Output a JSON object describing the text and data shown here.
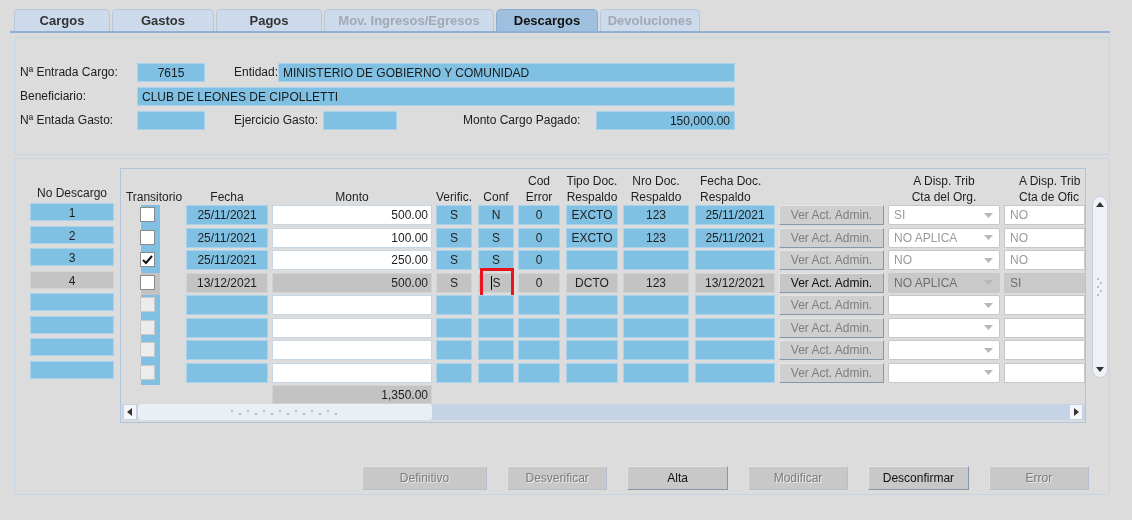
{
  "tabs": [
    {
      "label": "Cargos",
      "selected": false,
      "disabled": false
    },
    {
      "label": "Gastos",
      "selected": false,
      "disabled": false
    },
    {
      "label": "Pagos",
      "selected": false,
      "disabled": false
    },
    {
      "label": "Mov. Ingresos/Egresos",
      "selected": false,
      "disabled": true
    },
    {
      "label": "Descargos",
      "selected": true,
      "disabled": false
    },
    {
      "label": "Devoluciones",
      "selected": false,
      "disabled": true
    }
  ],
  "header": {
    "entrada_cargo": {
      "label": "Nª Entrada Cargo:",
      "value": "7615"
    },
    "entidad": {
      "label": "Entidad:",
      "value": "MINISTERIO DE GOBIERNO Y COMUNIDAD"
    },
    "beneficiario": {
      "label": "Beneficiario:",
      "value": "CLUB DE LEONES DE CIPOLLETTI"
    },
    "entrada_gasto": {
      "label": "Nª Entada Gasto:"
    },
    "ejercicio_gasto": {
      "label": "Ejercicio Gasto:"
    },
    "monto_cargo_pagado": {
      "label": "Monto Cargo Pagado:",
      "value": "150,000.00"
    }
  },
  "descargo_header": "No Descargo",
  "columns": [
    "Transitorio",
    "Fecha",
    "Monto",
    "Verific.",
    "Conf",
    "Cod\nError",
    "Tipo Doc.\nRespaldo",
    "Nro Doc.\nRespaldo",
    "Fecha Doc.\nRespaldo",
    "A Disp. Trib\nCta del Org.",
    "A Disp. Trib\nCta de Ofic"
  ],
  "rows": [
    {
      "kind": "record",
      "no": "1",
      "selected": false,
      "transitorio": false,
      "fecha": "25/11/2021",
      "monto": "500.00",
      "verific": "S",
      "conf": "N",
      "conf_highlighted": false,
      "cod_error": "0",
      "tipo_doc": "EXCTO",
      "nro_doc": "123",
      "fecha_doc": "25/11/2021",
      "action": {
        "label": "Ver Act. Admin.",
        "disabled": true
      },
      "disp_org": "SI",
      "disp_ofic": "NO"
    },
    {
      "kind": "record",
      "no": "2",
      "selected": false,
      "transitorio": false,
      "fecha": "25/11/2021",
      "monto": "100.00",
      "verific": "S",
      "conf": "S",
      "conf_highlighted": false,
      "cod_error": "0",
      "tipo_doc": "EXCTO",
      "nro_doc": "123",
      "fecha_doc": "25/11/2021",
      "action": {
        "label": "Ver Act. Admin.",
        "disabled": true
      },
      "disp_org": "NO APLICA",
      "disp_ofic": "NO"
    },
    {
      "kind": "record",
      "no": "3",
      "selected": false,
      "transitorio": true,
      "fecha": "25/11/2021",
      "monto": "250.00",
      "verific": "S",
      "conf": "S",
      "conf_highlighted": false,
      "cod_error": "0",
      "action": {
        "label": "Ver Act. Admin.",
        "disabled": true
      },
      "disp_org": "NO",
      "disp_ofic": "NO"
    },
    {
      "kind": "record",
      "no": "4",
      "selected": true,
      "transitorio": false,
      "fecha": "13/12/2021",
      "monto": "500.00",
      "verific": "S",
      "conf": "S",
      "conf_highlighted": true,
      "cod_error": "0",
      "tipo_doc": "DCTO",
      "nro_doc": "123",
      "fecha_doc": "13/12/2021",
      "action": {
        "label": "Ver Act. Admin.",
        "disabled": false
      },
      "disp_org": "NO APLICA",
      "disp_ofic": "SI"
    },
    {
      "kind": "blank",
      "selected": false,
      "transitorio": false,
      "conf_highlighted": false,
      "action": {
        "label": "Ver Act. Admin.",
        "disabled": true
      }
    },
    {
      "kind": "blank",
      "selected": false,
      "transitorio": false,
      "conf_highlighted": false,
      "action": {
        "label": "Ver Act. Admin.",
        "disabled": true
      }
    },
    {
      "kind": "blank",
      "selected": false,
      "transitorio": false,
      "conf_highlighted": false,
      "action": {
        "label": "Ver Act. Admin.",
        "disabled": true
      }
    },
    {
      "kind": "blank",
      "selected": false,
      "transitorio": false,
      "conf_highlighted": false,
      "action": {
        "label": "Ver Act. Admin.",
        "disabled": true
      }
    }
  ],
  "total": "1,350.00",
  "buttons": [
    {
      "label": "Definitivo",
      "disabled": true
    },
    {
      "label": "Desverificar",
      "disabled": true
    },
    {
      "label": "Alta",
      "disabled": false
    },
    {
      "label": "Modificar",
      "disabled": true
    },
    {
      "label": "Desconfirmar",
      "disabled": false
    },
    {
      "label": "Error",
      "disabled": true
    }
  ]
}
